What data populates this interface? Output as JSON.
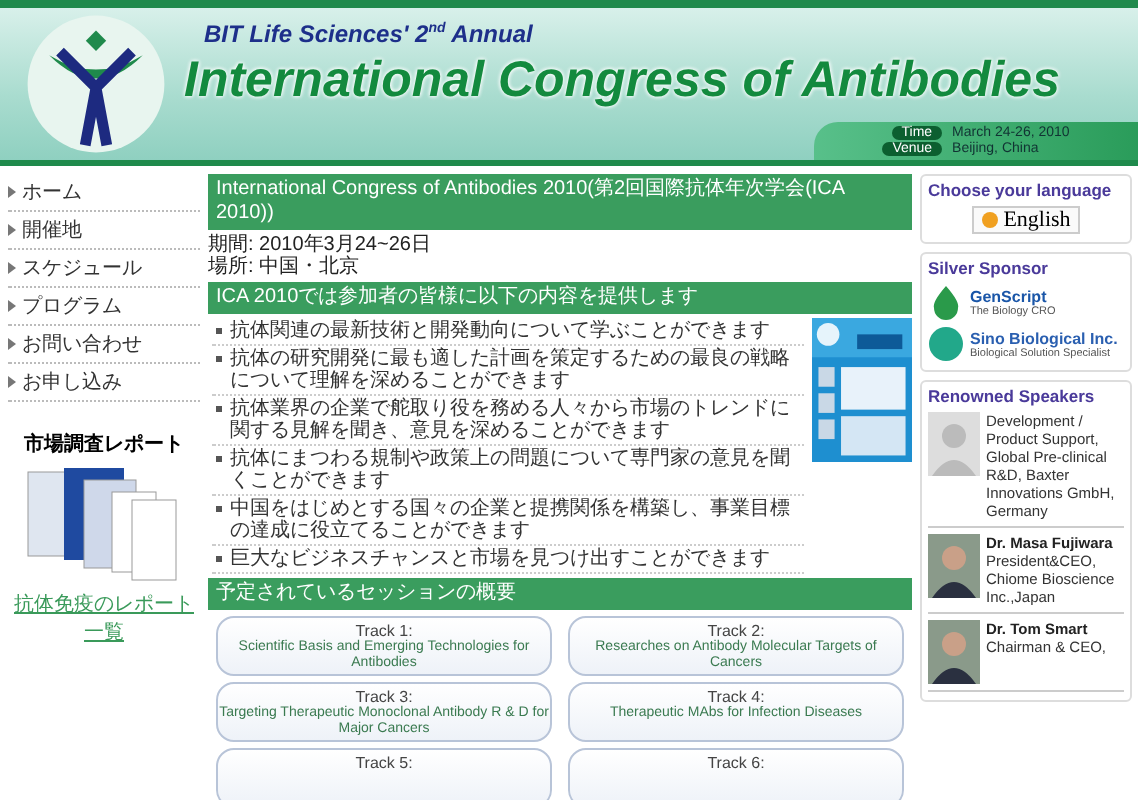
{
  "header": {
    "subtitle": "BIT Life Sciences' 2$^{nd}$ Annual",
    "title": "International Congress of Antibodies",
    "info": [
      {
        "label": "Time",
        "value": "March 24-26, 2010"
      },
      {
        "label": "Venue",
        "value": "Beijing, China"
      }
    ]
  },
  "nav": [
    {
      "label": "ホーム"
    },
    {
      "label": "開催地"
    },
    {
      "label": "スケジュール"
    },
    {
      "label": "プログラム"
    },
    {
      "label": "お問い合わせ"
    },
    {
      "label": "お申し込み"
    }
  ],
  "report": {
    "title": "市場調査レポート",
    "link": "抗体免疫のレポート一覧"
  },
  "main": {
    "title": "International Congress of Antibodies 2010(第2回国際抗体年次学会(ICA 2010))",
    "dates": [
      "期間: 2010年3月24~26日",
      "場所: 中国・北京"
    ],
    "offer_title": "ICA 2010では参加者の皆様に以下の内容を提供します",
    "bullets": [
      "抗体関連の最新技術と開発動向について学ぶことができます",
      "抗体の研究開発に最も適した計画を策定するための最良の戦略について理解を深めることができます",
      "抗体業界の企業で舵取り役を務める人々から市場のトレンドに関する見解を聞き、意見を深めることができます",
      "抗体にまつわる規制や政策上の問題について専門家の意見を聞くことができます",
      "中国をはじめとする国々の企業と提携関係を構築し、事業目標の達成に役立てることができます",
      "巨大なビジネスチャンスと市場を見つけ出すことができます"
    ],
    "sessions_title": "予定されているセッションの概要",
    "tracks": [
      {
        "label": "Track 1:",
        "topic": "Scientific Basis and Emerging Technologies for Antibodies"
      },
      {
        "label": "Track 2:",
        "topic": "Researches on Antibody Molecular Targets of Cancers"
      },
      {
        "label": "Track 3:",
        "topic": "Targeting Therapeutic Monoclonal Antibody R & D for Major Cancers"
      },
      {
        "label": "Track 4:",
        "topic": "Therapeutic MAbs for Infection Diseases"
      },
      {
        "label": "Track 5:"
      },
      {
        "label": "Track 6:"
      }
    ]
  },
  "language": {
    "title": "Choose your language",
    "button": "English"
  },
  "sponsors": {
    "title": "Silver Sponsor",
    "items": [
      {
        "name": "GenScript",
        "tagline": "The Biology CRO",
        "color": "#1a56a8"
      },
      {
        "name": "Sino Biological Inc.",
        "tagline": "Biological Solution Specialist",
        "color": "#2a5fb0"
      }
    ]
  },
  "speakers": {
    "title": "Renowned Speakers",
    "items": [
      {
        "bio": "Development / Product Support, Global Pre-clinical R&D, Baxter Innovations GmbH, Germany"
      },
      {
        "name": "Dr. Masa Fujiwara",
        "bio": "President&CEO, Chiome Bioscience Inc.,Japan"
      },
      {
        "name": "Dr. Tom Smart",
        "bio": "Chairman & CEO,"
      }
    ]
  }
}
